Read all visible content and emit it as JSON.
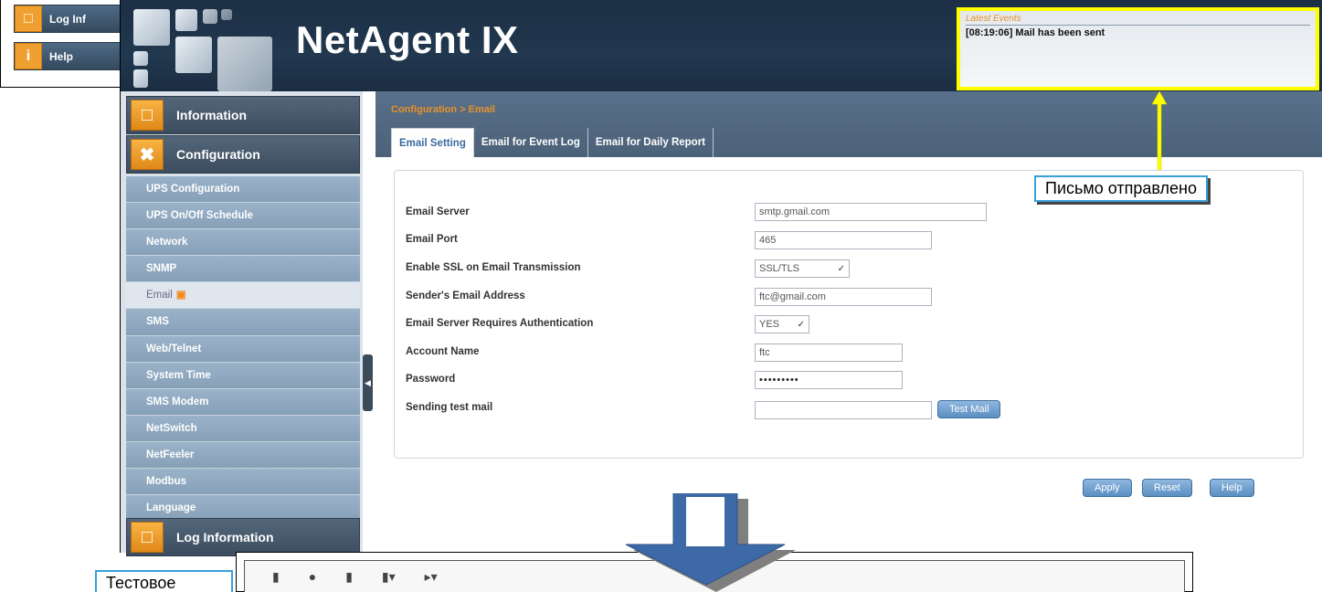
{
  "background": {
    "items": [
      {
        "label": "Log Inf",
        "icon": "folder-icon"
      },
      {
        "label": "Help",
        "icon": "info-icon"
      }
    ]
  },
  "header": {
    "title": "NetAgent IX"
  },
  "events": {
    "title": "Latest Events",
    "line": "[08:19:06] Mail has been sent"
  },
  "sidebar": {
    "sections": [
      {
        "label": "Information",
        "icon": "monitor-icon"
      },
      {
        "label": "Configuration",
        "icon": "tools-icon"
      },
      {
        "label": "Log Information",
        "icon": "folder-icon"
      }
    ],
    "items": [
      "UPS Configuration",
      "UPS On/Off Schedule",
      "Network",
      "SNMP",
      "Email",
      "SMS",
      "Web/Telnet",
      "System Time",
      "SMS Modem",
      "NetSwitch",
      "NetFeeler",
      "Modbus",
      "Language"
    ],
    "active_index": 4
  },
  "content": {
    "breadcrumb": "Configuration > Email",
    "tabs": [
      "Email Setting",
      "Email for Event Log",
      "Email for Daily Report"
    ],
    "active_tab": 0,
    "fields": {
      "server_label": "Email Server",
      "server_value": "smtp.gmail.com",
      "port_label": "Email Port",
      "port_value": "465",
      "ssl_label": "Enable SSL on Email Transmission",
      "ssl_value": "SSL/TLS",
      "sender_label": "Sender's Email Address",
      "sender_value": "ftc@gmail.com",
      "auth_label": "Email Server Requires Authentication",
      "auth_value": "YES",
      "account_label": "Account Name",
      "account_value": "ftc",
      "password_label": "Password",
      "password_value": "•••••••••",
      "test_label": "Sending test mail",
      "test_value": ""
    },
    "buttons": {
      "test_mail": "Test Mail",
      "apply": "Apply",
      "reset": "Reset",
      "help": "Help"
    }
  },
  "callouts": {
    "sent": "Письмо отправлено",
    "test": "Тестовое"
  },
  "colors": {
    "header_bg": "#1c2f45",
    "accent_orange": "#e9902a",
    "highlight_yellow": "#ffff00",
    "callout_border": "#3aa0d8"
  }
}
